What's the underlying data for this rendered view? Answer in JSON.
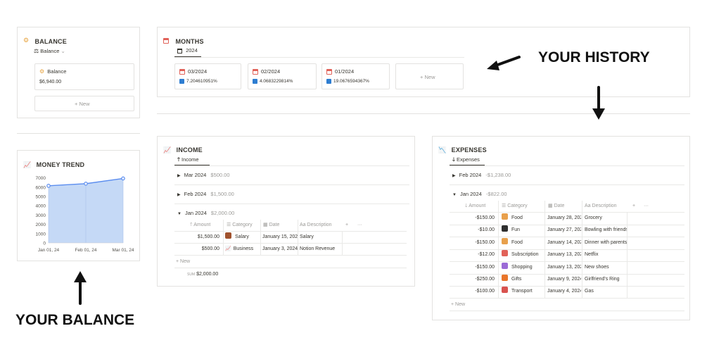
{
  "balance": {
    "title": "BALANCE",
    "view_label": "Balance",
    "card_title": "Balance",
    "card_value": "$6,940.00",
    "new_label": "New"
  },
  "months": {
    "title": "MONTHS",
    "tab": "2024",
    "cards": [
      {
        "title": "03/2024",
        "value": "7.204610951%"
      },
      {
        "title": "02/2024",
        "value": "4.0683229814%"
      },
      {
        "title": "01/2024",
        "value": "19.0676594367%"
      }
    ],
    "new_label": "New"
  },
  "annotations": {
    "history": "YOUR HISTORY",
    "balance": "YOUR BALANCE"
  },
  "money_trend": {
    "title": "MONEY TREND"
  },
  "chart_data": {
    "type": "area",
    "x": [
      "Jan 01, 24",
      "Feb 01, 24",
      "Mar 01, 24"
    ],
    "values": [
      6150,
      6380,
      6940
    ],
    "yticks": [
      "7000",
      "6000",
      "5000",
      "4000",
      "3000",
      "2000",
      "1000",
      "0"
    ],
    "ylim": [
      0,
      7200
    ],
    "color": "#5b8def",
    "fill": "#c5d9f6",
    "grid": false
  },
  "income": {
    "title": "INCOME",
    "tab": "Income",
    "groups": [
      {
        "label": "Mar 2024",
        "total": "$500.00"
      },
      {
        "label": "Feb 2024",
        "total": "$1,500.00"
      },
      {
        "label": "Jan 2024",
        "total": "$2,000.00"
      }
    ],
    "columns": [
      "Amount",
      "Category",
      "Date",
      "Description"
    ],
    "rows": [
      {
        "amount": "$1,500.00",
        "category": "Salary",
        "date": "January 15, 2024",
        "description": "Salary"
      },
      {
        "amount": "$500.00",
        "category": "Business",
        "date": "January 3, 2024",
        "description": "Notion Revenue"
      }
    ],
    "new_label": "New",
    "sum_label": "SUM",
    "sum_value": "$2,000.00"
  },
  "expenses": {
    "title": "EXPENSES",
    "tab": "Expenses",
    "groups": [
      {
        "label": "Feb 2024",
        "total": "-$1,238.00"
      },
      {
        "label": "Jan 2024",
        "total": "-$822.00"
      }
    ],
    "columns": [
      "Amount",
      "Category",
      "Date",
      "Description"
    ],
    "rows": [
      {
        "amount": "-$150.00",
        "category": "Food",
        "date": "January 28, 2024",
        "description": "Grocery",
        "color": "#e8a04c"
      },
      {
        "amount": "-$10.00",
        "category": "Fun",
        "date": "January 27, 2024",
        "description": "Bowling with friends",
        "color": "#2f2f2f"
      },
      {
        "amount": "-$150.00",
        "category": "Food",
        "date": "January 14, 2024",
        "description": "Dinner with parents",
        "color": "#e8a04c"
      },
      {
        "amount": "-$12.00",
        "category": "Subscription",
        "date": "January 13, 2024",
        "description": "Netflix",
        "color": "#e16259"
      },
      {
        "amount": "-$150.00",
        "category": "Shopping",
        "date": "January 13, 2024",
        "description": "New shoes",
        "color": "#9b6bd6"
      },
      {
        "amount": "-$250.00",
        "category": "Gifts",
        "date": "January 9, 2024",
        "description": "Girlfriend's Ring",
        "color": "#e9762b"
      },
      {
        "amount": "-$100.00",
        "category": "Transport",
        "date": "January 4, 2024",
        "description": "Gas",
        "color": "#d9534f"
      }
    ],
    "new_label": "New"
  }
}
